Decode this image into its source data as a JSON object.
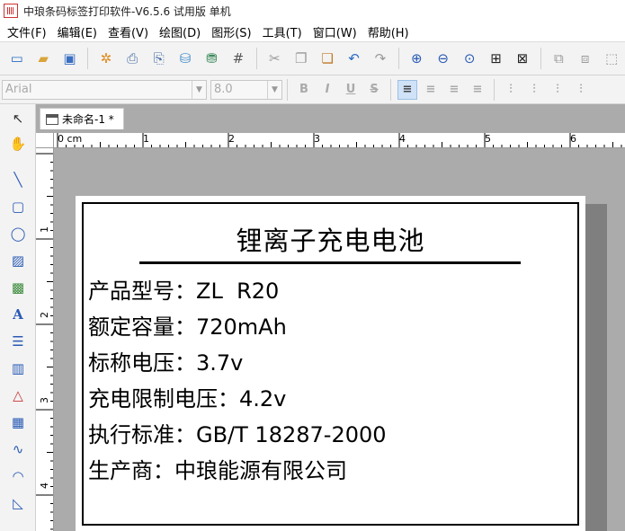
{
  "window": {
    "title": "中琅条码标签打印软件-V6.5.6 试用版 单机"
  },
  "menu": [
    "文件(F)",
    "编辑(E)",
    "查看(V)",
    "绘图(D)",
    "图形(S)",
    "工具(T)",
    "窗口(W)",
    "帮助(H)"
  ],
  "toolbar": {
    "icons": [
      "new-document-icon",
      "open-folder-icon",
      "save-icon",
      "settings-gear-icon",
      "print-icon",
      "print-preview-icon",
      "database-icon",
      "database-settings-icon",
      "grid-icon",
      "cut-icon",
      "copy-icon",
      "paste-icon",
      "undo-icon",
      "redo-icon",
      "zoom-in-icon",
      "zoom-out-icon",
      "zoom-fit-icon",
      "fit-page-icon",
      "fit-width-icon",
      "group-icon",
      "ungroup-icon",
      "more-icon"
    ]
  },
  "format": {
    "font_family_value": "Arial",
    "font_size_value": "8.0",
    "bold": "B",
    "italic": "I",
    "underline": "U",
    "strike": "S"
  },
  "document": {
    "tab_label": "未命名-1 *"
  },
  "ruler": {
    "h_labels": [
      "0 cm",
      "1",
      "2",
      "3",
      "4",
      "5",
      "6"
    ],
    "v_labels": [
      "1",
      "2",
      "3",
      "4"
    ]
  },
  "label": {
    "title": "锂离子充电电池",
    "lines": [
      "产品型号：ZL  R20",
      "额定容量：720mAh",
      "标称电压：3.7v",
      "充电限制电压：4.2v",
      "执行标准：GB/T 18287-2000",
      "生产商：中琅能源有限公司"
    ]
  }
}
